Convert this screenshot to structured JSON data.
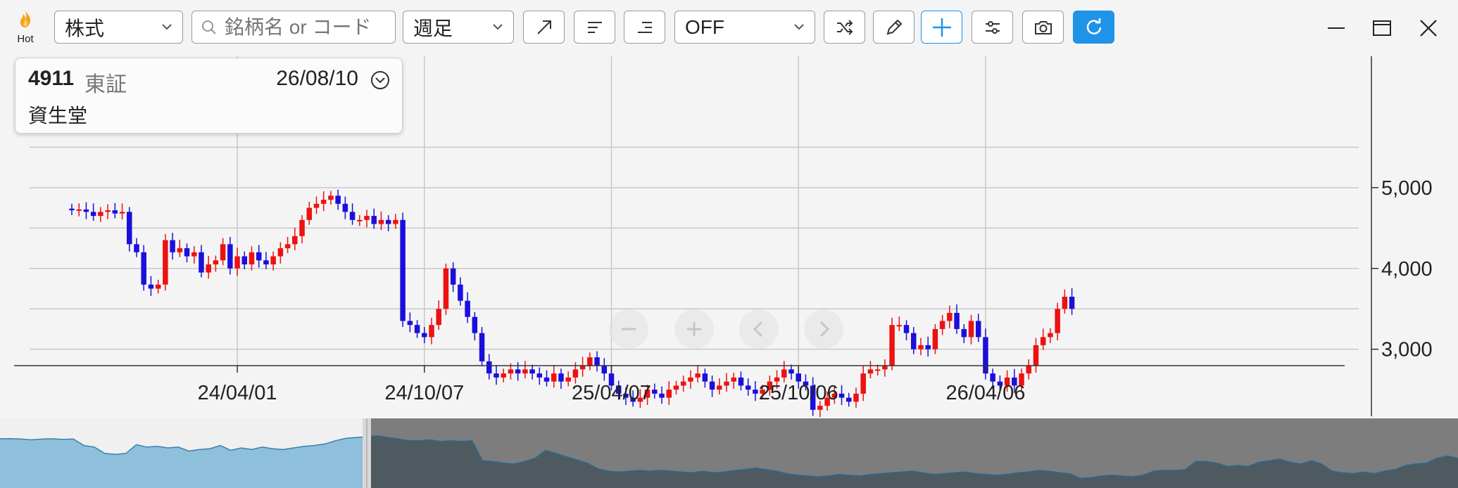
{
  "toolbar": {
    "hot_label": "Hot",
    "market_select": "株式",
    "search_placeholder": "銘柄名 or コード",
    "period_select": "週足",
    "indicator_select": "OFF"
  },
  "info_card": {
    "code": "4911",
    "exchange": "東証",
    "date": "26/08/10",
    "name": "資生堂"
  },
  "colors": {
    "up": "#ee1111",
    "down": "#1a0fdc",
    "accent": "#1f93e8",
    "navigator_fill": "#8ec0db"
  },
  "icons": [
    "flame-icon",
    "search-icon",
    "chevron-down-icon",
    "trend-line-icon",
    "horizontal-line-left-icon",
    "horizontal-line-right-icon",
    "shuffle-icon",
    "pencil-icon",
    "crosshair-plus-icon",
    "settings-sliders-icon",
    "camera-icon",
    "refresh-icon",
    "minimize-icon",
    "maximize-icon",
    "close-icon",
    "zoom-out-icon",
    "zoom-in-icon",
    "chevron-left-icon",
    "chevron-right-icon"
  ],
  "chart_data": {
    "type": "candlestick",
    "y_ticks": [
      3000,
      4000,
      5000
    ],
    "y_tick_labels": [
      "3,000",
      "4,000",
      "5,000"
    ],
    "ylim": [
      1970,
      5700
    ],
    "x_tick_labels": [
      "24/04/01",
      "24/10/07",
      "25/04/07",
      "25/10/06",
      "26/04/06"
    ],
    "x_tick_index": [
      23,
      49,
      75,
      101,
      127
    ],
    "candles_from_index": 0,
    "closes": [
      4720,
      4730,
      4700,
      4650,
      4700,
      4720,
      4680,
      4700,
      4300,
      4200,
      3800,
      3750,
      3800,
      4350,
      4200,
      4250,
      4150,
      4200,
      3950,
      4050,
      4100,
      4300,
      4000,
      4150,
      4050,
      4200,
      4100,
      4050,
      4150,
      4250,
      4300,
      4400,
      4600,
      4750,
      4800,
      4850,
      4900,
      4800,
      4700,
      4600,
      4600,
      4650,
      4550,
      4600,
      4550,
      4600,
      3350,
      3300,
      3200,
      3150,
      3300,
      3500,
      4000,
      3800,
      3600,
      3400,
      3200,
      2850,
      2700,
      2650,
      2700,
      2750,
      2700,
      2750,
      2700,
      2650,
      2600,
      2700,
      2600,
      2650,
      2750,
      2800,
      2900,
      2800,
      2700,
      2550,
      2450,
      2400,
      2350,
      2400,
      2500,
      2450,
      2400,
      2500,
      2550,
      2600,
      2650,
      2700,
      2600,
      2500,
      2550,
      2600,
      2650,
      2550,
      2500,
      2450,
      2500,
      2600,
      2650,
      2750,
      2700,
      2600,
      2550,
      2250,
      2300,
      2400,
      2450,
      2400,
      2350,
      2450,
      2700,
      2750,
      2750,
      2800,
      3300,
      3300,
      3200,
      3000,
      3050,
      3000,
      3250,
      3350,
      3450,
      3250,
      3150,
      3350,
      3150,
      2700,
      2600,
      2550,
      2650,
      2550,
      2700,
      2800,
      3050,
      3150,
      3200,
      3500,
      3650,
      3500
    ]
  }
}
